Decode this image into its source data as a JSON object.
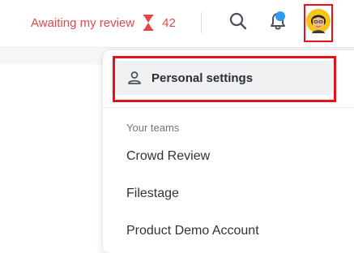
{
  "header": {
    "awaiting_label": "Awaiting my review",
    "awaiting_count": "42",
    "icons": [
      "hourglass-icon",
      "search-icon",
      "bell-icon",
      "avatar"
    ]
  },
  "menu": {
    "personal_settings_label": "Personal settings",
    "section_label": "Your teams",
    "teams": [
      "Crowd Review",
      "Filestage",
      "Product Demo Account"
    ]
  },
  "colors": {
    "accent_red": "#e04a4a",
    "annotation_red": "#e8101b",
    "notification_blue": "#2f9bf0",
    "avatar_yellow": "#f5c518"
  }
}
